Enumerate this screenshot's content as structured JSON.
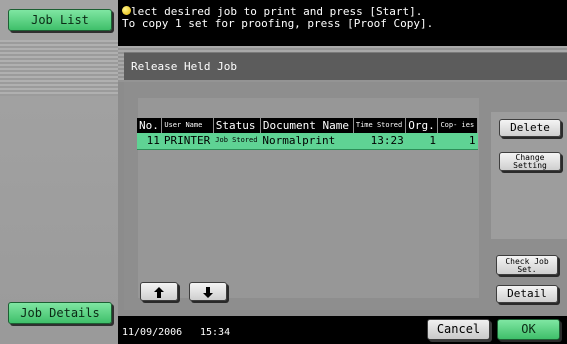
{
  "left": {
    "job_list_label": "Job List",
    "job_details_label": "Job Details"
  },
  "message": {
    "line1": "lect desired job to print and press [Start].",
    "line2": "To copy 1 set for proofing, press [Proof Copy].",
    "icon": "info-bulb-icon"
  },
  "panel": {
    "title": "Release Held Job"
  },
  "table": {
    "headers": {
      "no": "No.",
      "user_name": "User Name",
      "status": "Status",
      "document_name": "Document Name",
      "time_stored": "Time Stored",
      "org": "Org.",
      "copies": "Cop- ies"
    },
    "rows": [
      {
        "no": "11",
        "user_name": "PRINTER",
        "status": "Job Stored",
        "document_name": "Normalprint",
        "time_stored": "13:23",
        "org": "1",
        "copies": "1"
      }
    ]
  },
  "buttons": {
    "delete": "Delete",
    "change_setting": "Change Setting",
    "check_job_set": "Check Job Set.",
    "detail": "Detail",
    "cancel": "Cancel",
    "ok": "OK",
    "up_icon": "up-arrow-icon",
    "down_icon": "down-arrow-icon"
  },
  "status_bar": {
    "date": "11/09/2006",
    "time": "15:34"
  },
  "colors": {
    "accent_green": "#4fd07f",
    "row_highlight": "#5fd394",
    "background_gray": "#8c8c8c"
  }
}
